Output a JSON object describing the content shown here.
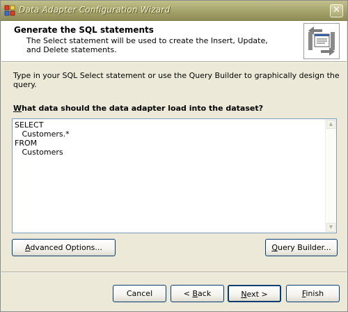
{
  "window": {
    "title": "Data Adapter Configuration Wizard",
    "close_symbol": "✕"
  },
  "header": {
    "title": "Generate the SQL statements",
    "description": "The Select statement will be used to create the Insert, Update, and Delete statements."
  },
  "instruction": "Type in your SQL Select statement or use the Query Builder to graphically design the query.",
  "question": {
    "mnemonic": "W",
    "rest": "hat data should the data adapter load into the dataset?"
  },
  "sql_editor": {
    "text": "SELECT\n   Customers.*\nFROM\n   Customers"
  },
  "buttons": {
    "advanced": {
      "mnemonic": "A",
      "rest": "dvanced Options..."
    },
    "query_builder": {
      "mnemonic": "Q",
      "rest": "uery Builder..."
    },
    "cancel": {
      "label": "Cancel"
    },
    "back": {
      "prefix": "< ",
      "mnemonic": "B",
      "rest": "ack"
    },
    "next": {
      "mnemonic": "N",
      "rest": "ext >"
    },
    "finish": {
      "mnemonic": "F",
      "rest": "inish"
    }
  },
  "icons": {
    "app": "wizard-app-icon",
    "header": "sql-generate-icon",
    "scroll_up": "▲",
    "scroll_down": "▼"
  },
  "colors": {
    "titlebar": "#a9a770",
    "window_bg": "#ece9d8",
    "button_border": "#003c74",
    "editor_border": "#7f9db9"
  }
}
